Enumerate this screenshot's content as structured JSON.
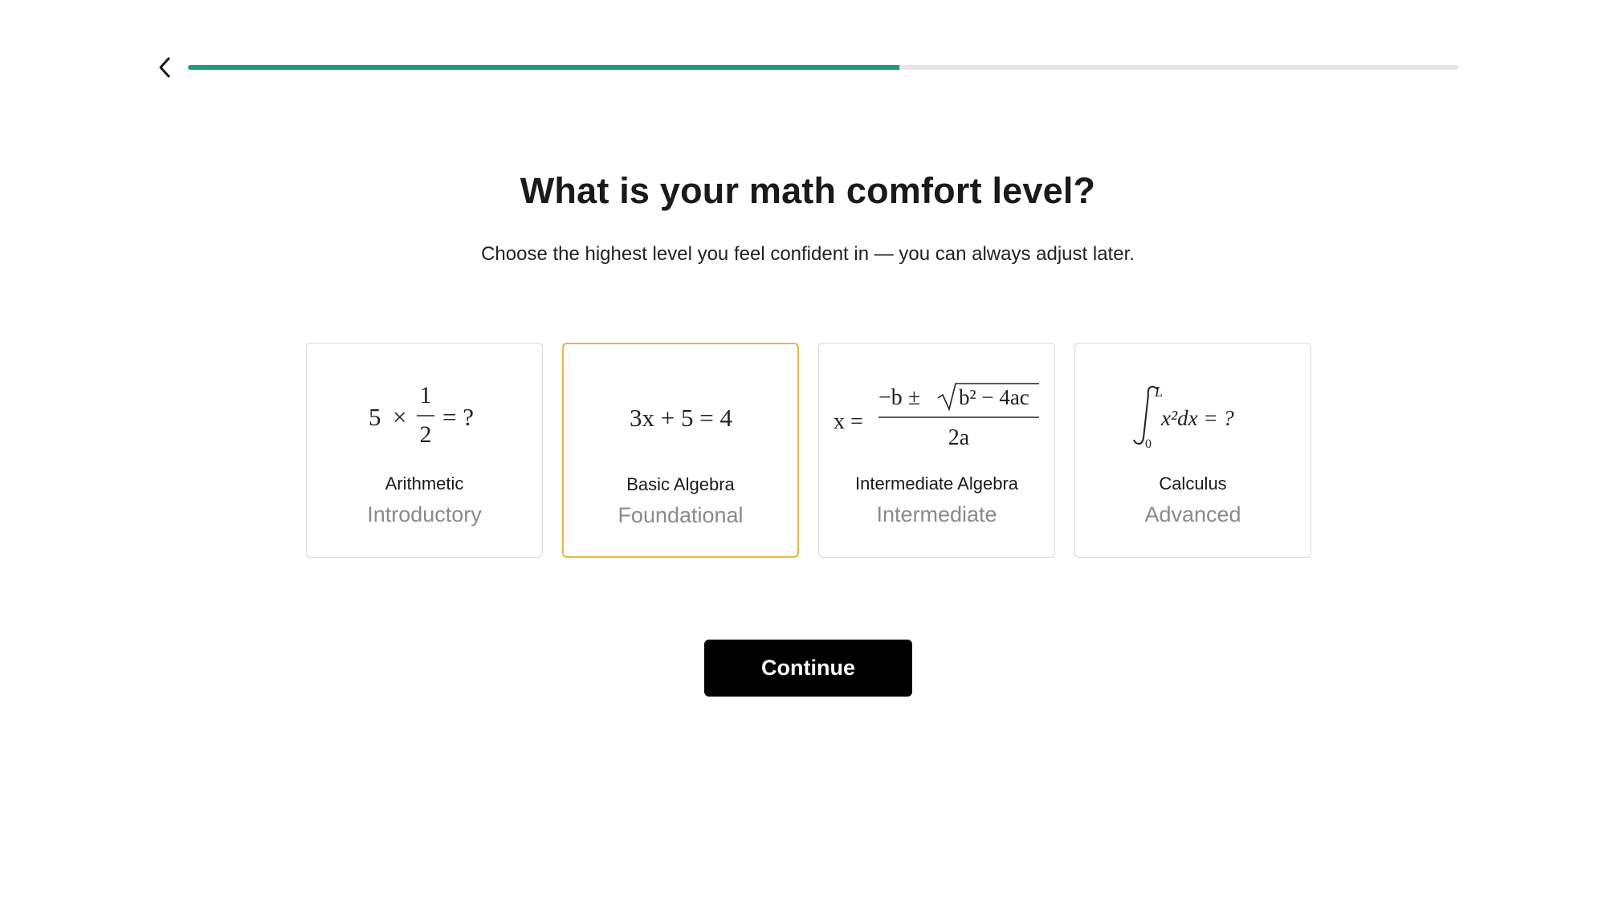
{
  "progress": {
    "fraction": 0.56
  },
  "header": {
    "title": "What is your math comfort level?",
    "subtitle": "Choose the highest level you feel confident in — you can always adjust later."
  },
  "options": [
    {
      "name": "Arithmetic",
      "level": "Introductory",
      "selected": false,
      "formula": {
        "a": "5",
        "times": "×",
        "num": "1",
        "den": "2",
        "rest": "= ?"
      }
    },
    {
      "name": "Basic Algebra",
      "level": "Foundational",
      "selected": true,
      "formula": {
        "text": "3x + 5 = 4"
      }
    },
    {
      "name": "Intermediate Algebra",
      "level": "Intermediate",
      "selected": false,
      "formula": {
        "lhs": "x =",
        "num_pre": "−b ±",
        "radicand": "b² − 4ac",
        "den": "2a"
      }
    },
    {
      "name": "Calculus",
      "level": "Advanced",
      "selected": false,
      "formula": {
        "upper": "L",
        "lower": "0",
        "integrand": "x²dx = ?"
      }
    }
  ],
  "actions": {
    "continue_label": "Continue"
  },
  "colors": {
    "accent": "#1e9a7a",
    "selected_border": "#e8b64a",
    "button": "#000000"
  }
}
